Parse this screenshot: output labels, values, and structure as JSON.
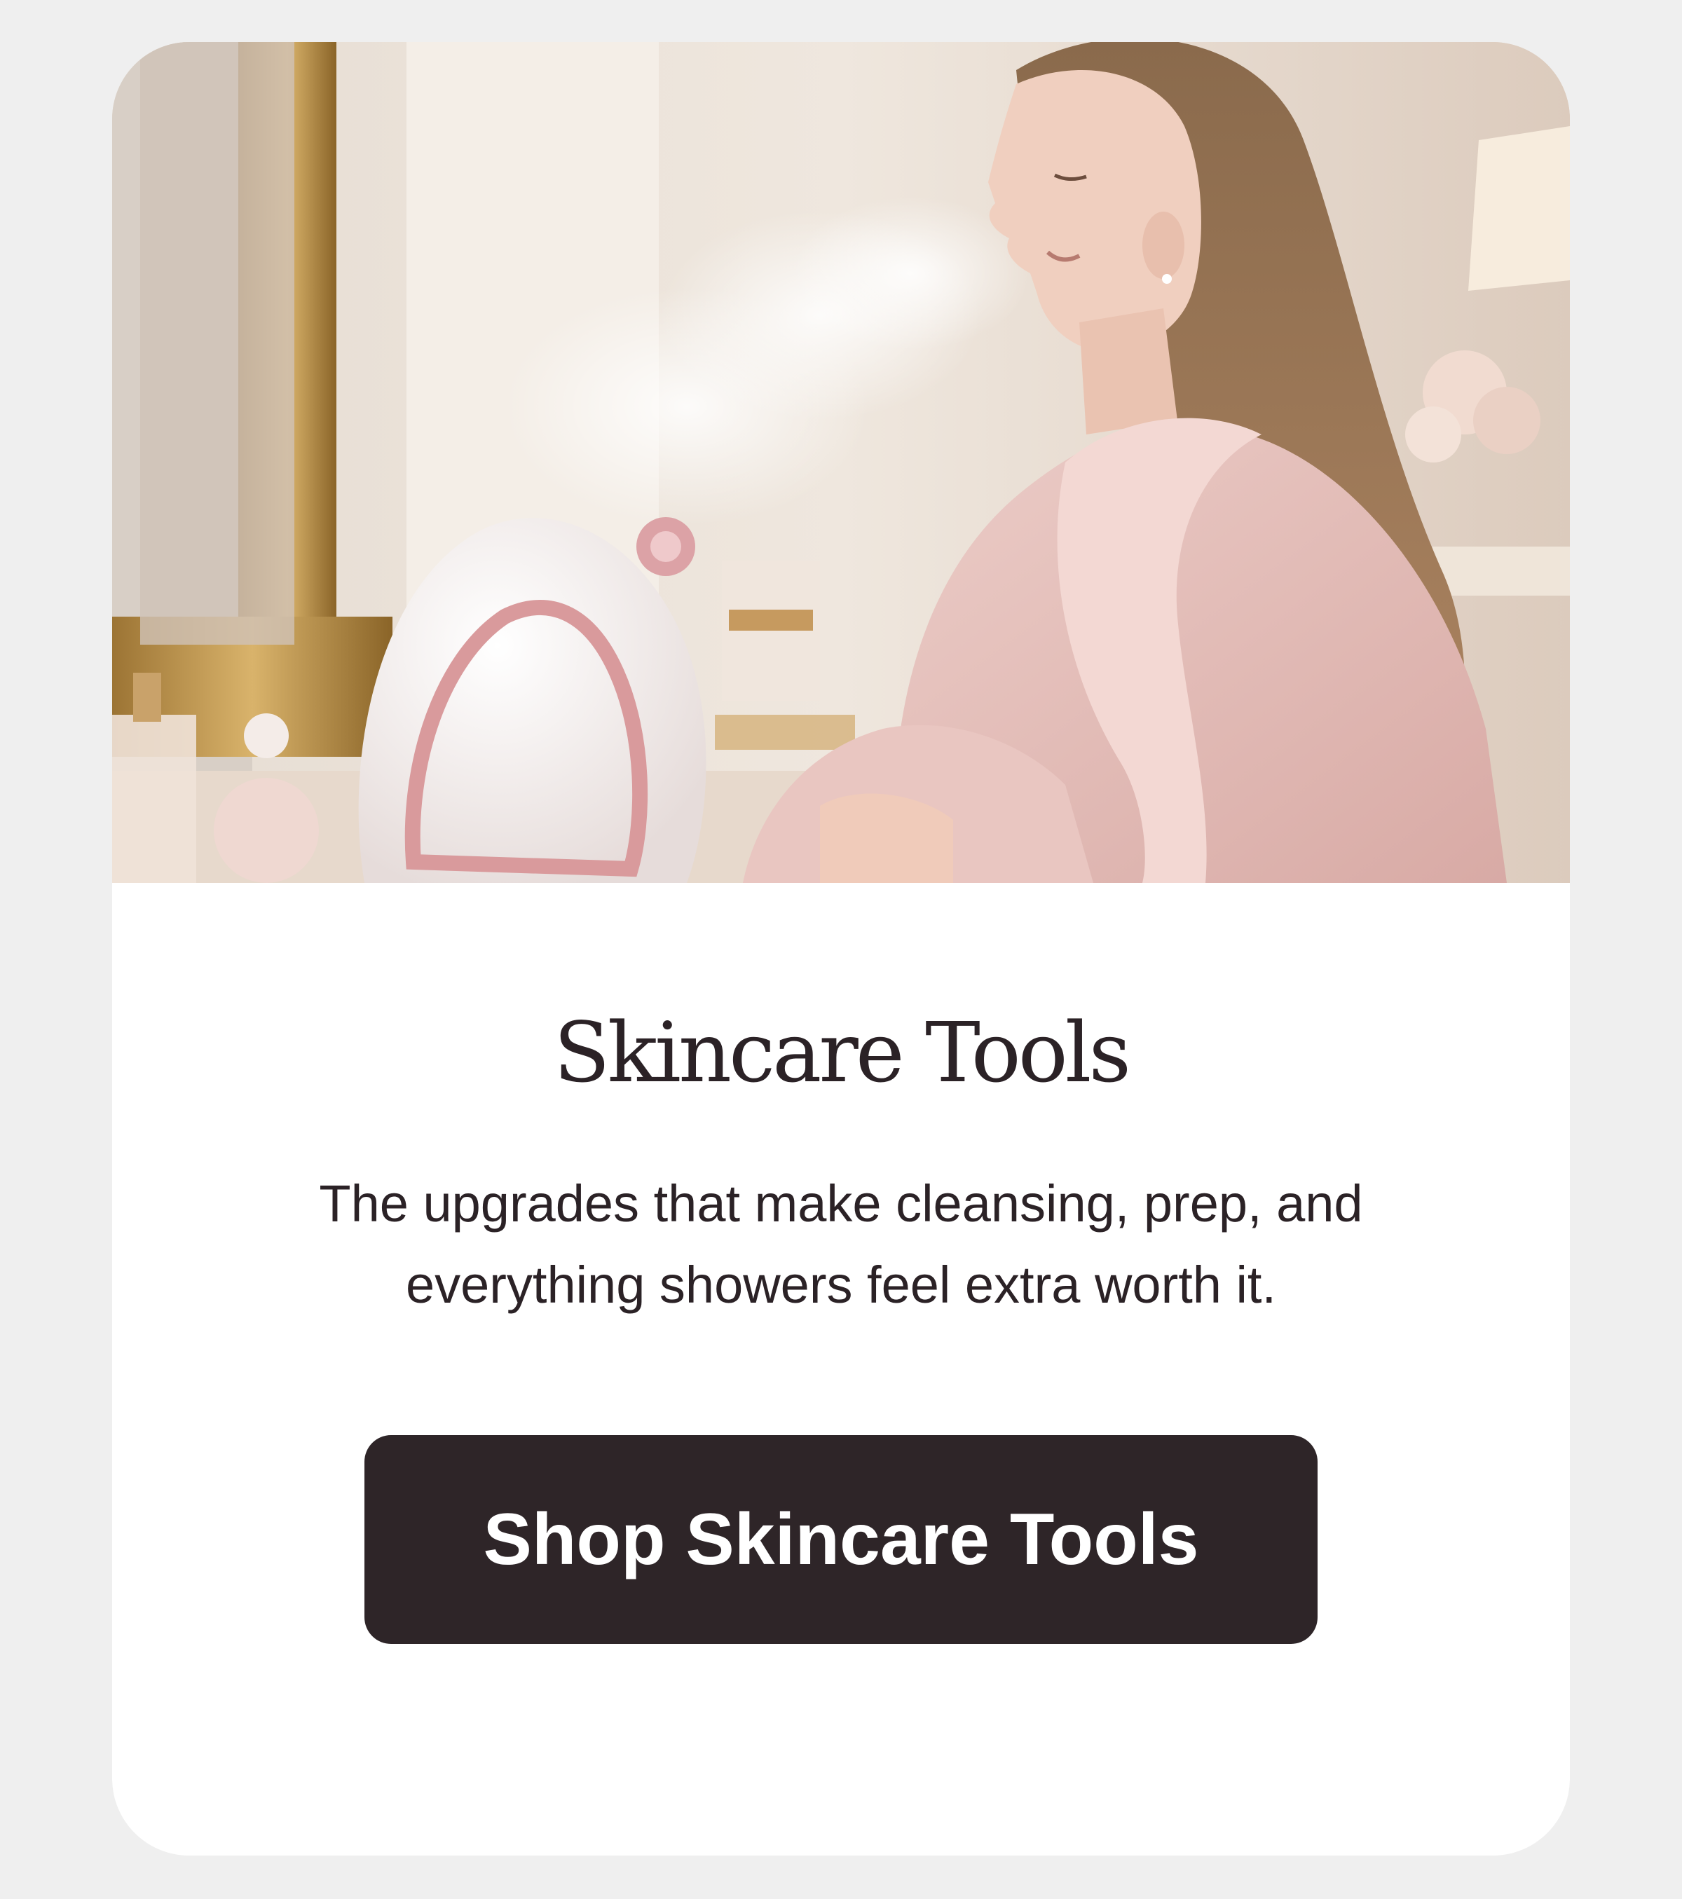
{
  "card": {
    "image_alt": "Woman in a pink robe using a facial steamer at a vanity mirror",
    "title": "Skincare Tools",
    "description": "The upgrades that make cleansing, prep, and everything showers feel extra worth it.",
    "cta_label": "Shop Skincare Tools"
  },
  "colors": {
    "page_background": "#efefef",
    "card_background": "#ffffff",
    "text": "#2b2226",
    "button_background": "#2e2528",
    "button_text": "#ffffff"
  }
}
